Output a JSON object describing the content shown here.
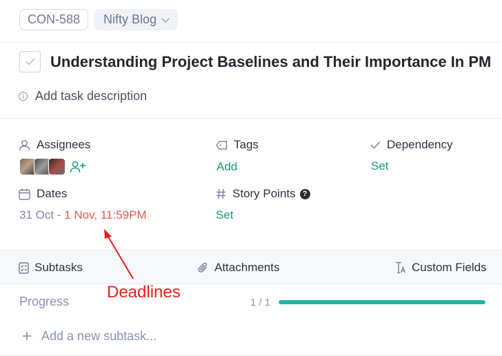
{
  "header": {
    "task_id": "CON-588",
    "project": "Nifty Blog"
  },
  "task": {
    "title": "Understanding Project Baselines and Their Importance In PM",
    "description_placeholder": "Add task description"
  },
  "fields": {
    "assignees": {
      "label": "Assignees"
    },
    "tags": {
      "label": "Tags",
      "action": "Add"
    },
    "dependency": {
      "label": "Dependency",
      "action": "Set"
    },
    "dates": {
      "label": "Dates",
      "start": "31 Oct -",
      "end": "1 Nov, 11:59PM"
    },
    "story_points": {
      "label": "Story Points",
      "help": "?",
      "action": "Set"
    }
  },
  "tabs": [
    {
      "label": "Subtasks",
      "icon": "checklist-icon"
    },
    {
      "label": "Attachments",
      "icon": "paperclip-icon"
    },
    {
      "label": "Custom Fields",
      "icon": "text-field-icon"
    }
  ],
  "progress": {
    "label": "Progress",
    "count": "1 / 1",
    "fraction": 1.0
  },
  "subtask": {
    "add_placeholder": "Add a new subtask..."
  },
  "annotation": {
    "text": "Deadlines",
    "color": "#e81e1e"
  },
  "colors": {
    "accent": "#16997a",
    "overdue": "#e25a4e",
    "progress": "#1eb5a3",
    "muted": "#8b92b3"
  }
}
